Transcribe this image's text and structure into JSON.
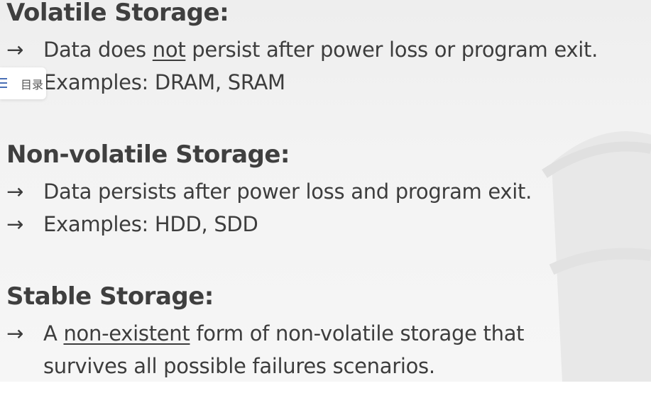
{
  "slide": {
    "sections": [
      {
        "heading": "Volatile Storage:",
        "arrow": "→",
        "line1_pre": "Data does ",
        "line1_emph": "not",
        "line1_post": " persist after power loss or program exit.",
        "line2": "Examples: DRAM, SRAM"
      },
      {
        "heading": "Non-volatile Storage:",
        "arrow": "→",
        "line1": "Data persists after power loss and program exit.",
        "line2": "Examples: HDD, SDD"
      },
      {
        "heading": "Stable Storage:",
        "arrow": "→",
        "line1_pre": "A ",
        "line1_emph": "non-existent",
        "line1_post": " form of non-volatile storage that",
        "line2": "survives all possible failures scenarios."
      }
    ]
  },
  "toc": {
    "label": "目录",
    "icon": "list-icon"
  }
}
